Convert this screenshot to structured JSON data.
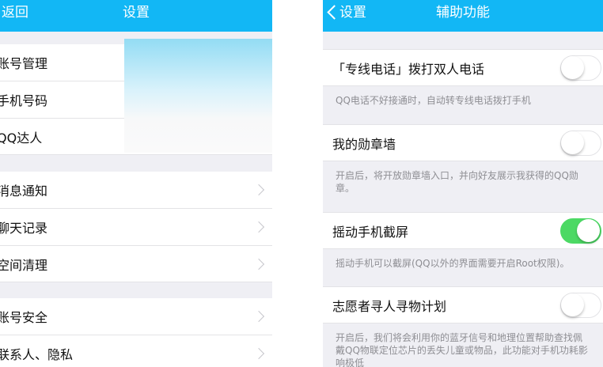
{
  "left": {
    "back": "返回",
    "title": "设置",
    "groups": [
      [
        "账号管理",
        "手机号码",
        "QQ达人"
      ],
      [
        "消息通知",
        "聊天记录",
        "空间清理"
      ],
      [
        "账号安全",
        "联系人、隐私"
      ]
    ]
  },
  "right": {
    "back": "设置",
    "title": "辅助功能",
    "items": [
      {
        "label": "「专线电话」拨打双人电话",
        "on": false,
        "desc": "QQ电话不好接通时，自动转专线电话拨打手机"
      },
      {
        "label": "我的勋章墙",
        "on": false,
        "desc": "开启后，将开放勋章墙入口，并向好友展示我获得的QQ勋章。"
      },
      {
        "label": "摇动手机截屏",
        "on": true,
        "desc": "摇动手机可以截屏(QQ以外的界面需要开启Root权限)。"
      },
      {
        "label": "志愿者寻人寻物计划",
        "on": false,
        "desc": "开启后，我们将会利用你的蓝牙信号和地理位置帮助查找佩戴QQ物联定位芯片的丢失儿童或物品，此功能对手机功耗影响极低"
      }
    ],
    "colors": {
      "header": "#12b7f5",
      "toggle_on": "#4cd964"
    }
  }
}
